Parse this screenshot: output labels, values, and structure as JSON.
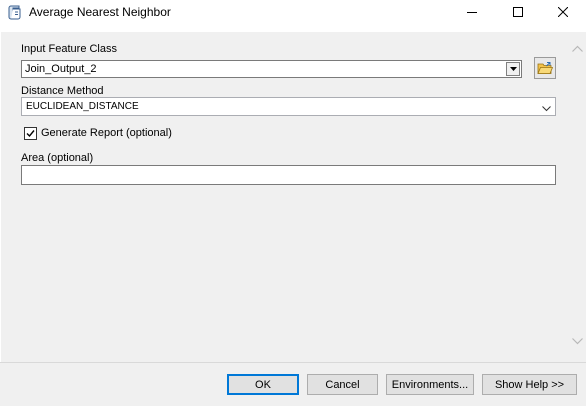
{
  "window": {
    "title": "Average Nearest Neighbor",
    "icon": "script-tool-icon"
  },
  "form": {
    "input_feature_class": {
      "label": "Input Feature Class",
      "value": "Join_Output_2"
    },
    "distance_method": {
      "label": "Distance Method",
      "value": "EUCLIDEAN_DISTANCE"
    },
    "generate_report": {
      "label": "Generate Report (optional)",
      "checked": true
    },
    "area": {
      "label": "Area (optional)",
      "value": ""
    }
  },
  "buttons": {
    "ok": "OK",
    "cancel": "Cancel",
    "environments": "Environments...",
    "show_help": "Show Help >>"
  },
  "colors": {
    "panel_bg": "#f0f0f0",
    "default_button_border": "#0078d7"
  }
}
